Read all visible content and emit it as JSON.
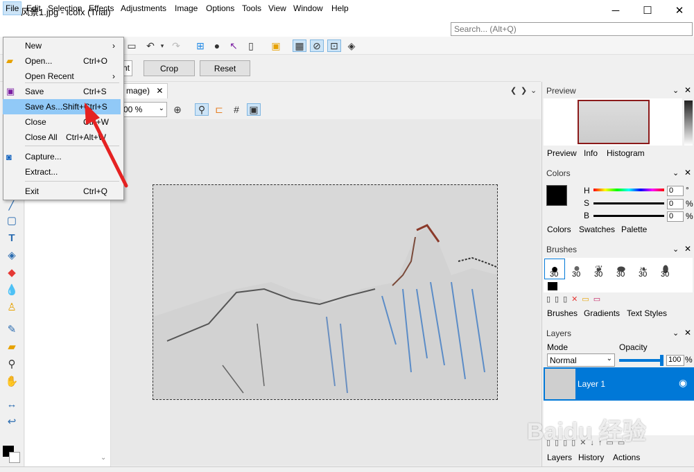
{
  "window": {
    "title": "风景1.jpg - icofx (Trial)",
    "minimize": "─",
    "maximize": "☐",
    "close": "✕"
  },
  "menubar": [
    "File",
    "Edit",
    "Selection",
    "Effects",
    "Adjustments",
    "Image",
    "Options",
    "Tools",
    "View",
    "Window",
    "Help"
  ],
  "search": {
    "placeholder": "Search... (Alt+Q)"
  },
  "optbar": {
    "crop": "Crop",
    "reset": "Reset",
    "field_partial": "nt"
  },
  "document": {
    "tab_label": "mage)",
    "tab_close": "✕",
    "zoom": "00 %"
  },
  "file_menu": {
    "items": [
      {
        "label": "New",
        "shortcut": "",
        "submenu": true
      },
      {
        "label": "Open...",
        "shortcut": "Ctrl+O",
        "submenu": false
      },
      {
        "label": "Open Recent",
        "shortcut": "",
        "submenu": true
      },
      {
        "label": "Save",
        "shortcut": "Ctrl+S",
        "submenu": false
      },
      {
        "label": "Save As...",
        "shortcut": "Shift+Ctrl+S",
        "submenu": false
      },
      {
        "label": "Close",
        "shortcut": "Ctrl+W",
        "submenu": false
      },
      {
        "label": "Close All",
        "shortcut": "Ctrl+Alt+W",
        "submenu": false
      },
      {
        "label": "Capture...",
        "shortcut": "",
        "submenu": false
      },
      {
        "label": "Extract...",
        "shortcut": "",
        "submenu": false
      },
      {
        "label": "Exit",
        "shortcut": "Ctrl+Q",
        "submenu": false
      }
    ],
    "highlighted": "Save As..."
  },
  "panels": {
    "preview": {
      "title": "Preview",
      "tabs": [
        "Preview",
        "Info",
        "Histogram"
      ]
    },
    "colors": {
      "title": "Colors",
      "h_label": "H",
      "s_label": "S",
      "b_label": "B",
      "h": "0",
      "s": "0",
      "b": "0",
      "deg": "°",
      "pct": "%",
      "tabs": [
        "Colors",
        "Swatches",
        "Palette"
      ]
    },
    "brushes": {
      "title": "Brushes",
      "sizes": [
        "30",
        "30",
        "30",
        "30",
        "30",
        "30"
      ],
      "tabs": [
        "Brushes",
        "Gradients",
        "Text Styles"
      ]
    },
    "layers": {
      "title": "Layers",
      "mode_label": "Mode",
      "opacity_label": "Opacity",
      "mode": "Normal",
      "opacity": "100",
      "opacity_unit": "%",
      "layer_name": "Layer 1",
      "tabs": [
        "Layers",
        "History",
        "Actions"
      ]
    }
  },
  "watermark": "Baidu 经验",
  "colors": {
    "accent": "#0078d7",
    "menu_highlight": "#91c9f7",
    "arrow": "#e52222"
  }
}
